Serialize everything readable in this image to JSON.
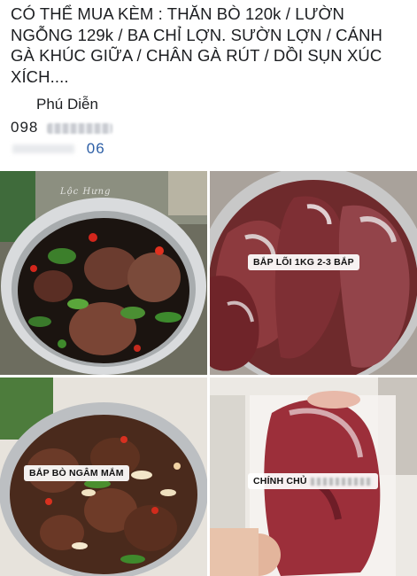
{
  "post": {
    "body_text": "CÓ THỂ MUA KÈM : THĂN BÒ 120k / LƯỜN NGỖNG 129k / BA CHỈ LỢN. SƯỜN LỢN / CÁNH GÀ KHÚC GIỮA / CHÂN GÀ RÚT / DỒI SỤN XÚC XÍCH....",
    "location": "Phú Diễn",
    "phone_visible_start": "098",
    "phone_visible_end": "06"
  },
  "photos": [
    {
      "id": "photo-1",
      "watermark": "Lộc Hưng"
    },
    {
      "id": "photo-2",
      "caption": "BẮP LÕI 1KG 2-3 BẮP"
    },
    {
      "id": "photo-3",
      "caption": "BẮP BÒ NGÂM MẮM"
    },
    {
      "id": "photo-4",
      "caption": "CHÍNH CHỦ"
    }
  ],
  "colors": {
    "text": "#1c1e21",
    "link": "#2d5fa6",
    "caption_bg": "#ffffff"
  }
}
